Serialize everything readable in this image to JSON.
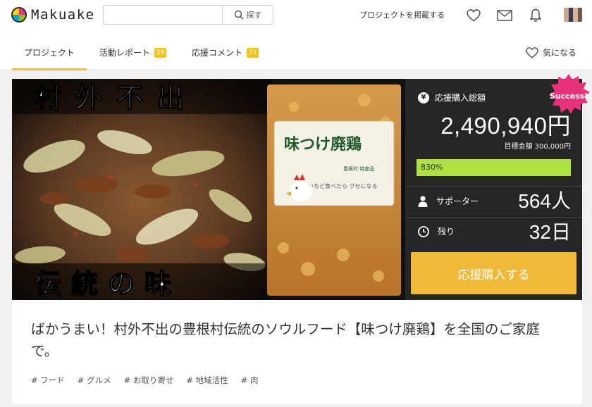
{
  "header": {
    "logo_text": "Makuake",
    "search_placeholder": "",
    "search_button": "探す",
    "post_link": "プロジェクトを掲載する",
    "icons": [
      "heart-icon",
      "mail-icon",
      "bell-icon",
      "avatar"
    ]
  },
  "tabs": [
    {
      "label": "プロジェクト",
      "badge": ""
    },
    {
      "label": "活動レポート",
      "badge": "28"
    },
    {
      "label": "応援コメント",
      "badge": "71"
    }
  ],
  "favorite": {
    "label": "気になる"
  },
  "hero": {
    "headline_top": "村外不出",
    "headline_bottom": "伝統の味",
    "package_title": "味つけ廃鶏",
    "package_sub": "いちど食べたら クセになる",
    "package_side": "豊根村 特産品"
  },
  "panel": {
    "total_label": "応援購入総額",
    "amount": "2,490,940円",
    "goal": "目標金額 300,000円",
    "progress_text": "830%",
    "progress_fraction": 1.0,
    "supporters_label": "サポーター",
    "supporters_value": "564人",
    "remaining_label": "残り",
    "remaining_value": "32日",
    "cta": "応援購入する",
    "success_badge": "Success!"
  },
  "project": {
    "title": "ばかうまい！村外不出の豊根村伝統のソウルフード【味つけ廃鶏】を全国のご家庭で。",
    "tags": [
      "# フード",
      "# グルメ",
      "# お取り寄せ",
      "# 地域活性",
      "# 肉"
    ]
  },
  "colors": {
    "accent": "#f0c419",
    "progress": "#aee23f",
    "cta": "#f0b93a",
    "success": "#e8327c",
    "panel_bg": "#262626"
  }
}
